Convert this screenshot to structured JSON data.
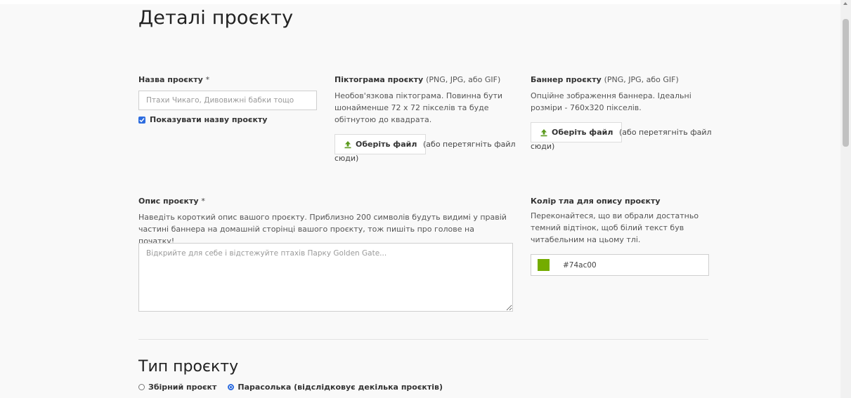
{
  "details": {
    "title": "Деталі проєкту",
    "name": {
      "label": "Назва проєкту",
      "required_mark": "*",
      "placeholder": "Птахи Чикаго, Дивовижні бабки тощо",
      "show_name_label": "Показувати назву проєкту",
      "show_name_checked": true
    },
    "icon": {
      "label": "Піктограма проєкту",
      "formats": "(PNG, JPG, або GIF)",
      "help": "Необов'язкова піктограма. Повинна бути шонайменше 72 x 72 пікселів та буде обітнутою до квадрата.",
      "button_label": "Оберіть файл",
      "drag_hint": "(або перетягніть файл сюди)"
    },
    "banner": {
      "label": "Баннер проєкту",
      "formats": "(PNG, JPG, або GIF)",
      "help": "Опційне зображення баннера. Ідеальні розміри - 760x320 пікселів.",
      "button_label": "Оберіть файл",
      "drag_hint": "(або перетягніть файл сюди)"
    },
    "description": {
      "label": "Опис проєкту",
      "required_mark": "*",
      "help": "Наведіть короткий опис вашого проєкту. Приблизно 200 символів будуть видимі у правій частині баннера на домашній сторінці вашого проєкту, тож пишіть про голове на початку!",
      "placeholder": "Відкрийте для себе і відстежуйте птахів Парку Golden Gate..."
    },
    "bg_color": {
      "label": "Колір тла для опису проєкту",
      "help": "Переконайтеся, що ви обрали достатньо темний відтінок, щоб білий текст був читабельним на цьому тлі.",
      "value": "#74ac00"
    }
  },
  "project_type": {
    "title": "Тип проєкту",
    "options": [
      {
        "label": "Збірний проєкт",
        "selected": false
      },
      {
        "label": "Парасолька (відслідковує декілька проєктів)",
        "selected": true
      }
    ]
  },
  "colors": {
    "accent": "#2d6cdf",
    "upload_icon": "#5a9a1c",
    "swatch": "#74ac00"
  },
  "icons": {
    "upload": "upload-arrow-icon",
    "check": "check-icon"
  }
}
